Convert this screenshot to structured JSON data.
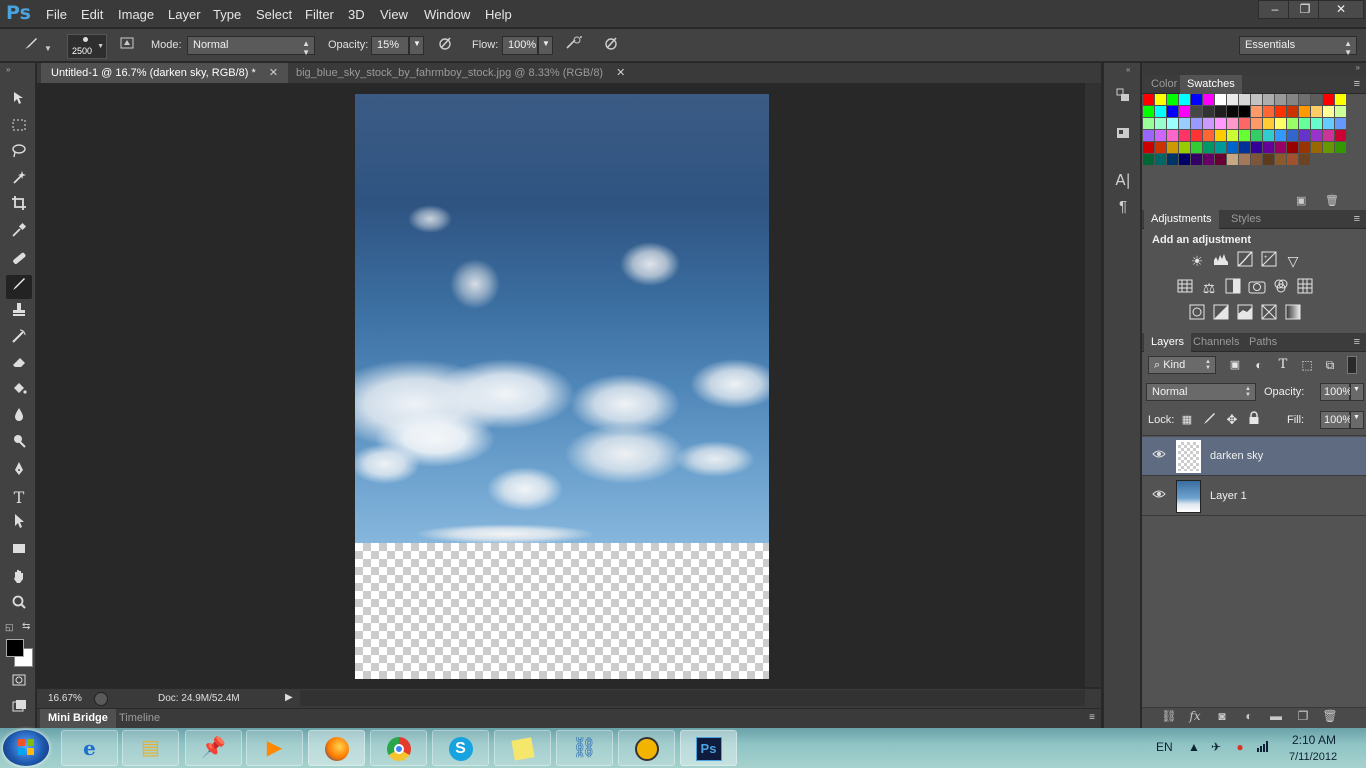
{
  "app": {
    "logo": "Ps",
    "title_colors": {
      "accent": "#4aa3df",
      "selected_layer": "#5e6b80"
    }
  },
  "menu": {
    "items": [
      "File",
      "Edit",
      "Image",
      "Layer",
      "Type",
      "Select",
      "Filter",
      "3D",
      "View",
      "Window",
      "Help"
    ]
  },
  "window_controls": {
    "minimize": "–",
    "restore": "❐",
    "close": "✕"
  },
  "options": {
    "brush_size": "2500",
    "mode_label": "Mode:",
    "mode_value": "Normal",
    "opacity_label": "Opacity:",
    "opacity_value": "15%",
    "flow_label": "Flow:",
    "flow_value": "100%",
    "workspace": "Essentials"
  },
  "tabs": [
    {
      "label": "Untitled-1 @ 16.7% (darken sky, RGB/8) *",
      "close": "✕"
    },
    {
      "label": "big_blue_sky_stock_by_fahrmboy_stock.jpg @ 8.33% (RGB/8)",
      "close": "✕"
    }
  ],
  "status": {
    "zoom": "16.67%",
    "doc": "Doc: 24.9M/52.4M"
  },
  "bottom_tabs": [
    "Mini Bridge",
    "Timeline"
  ],
  "panels": {
    "color_tabs": [
      "Color",
      "Swatches"
    ],
    "adjust_tabs": [
      "Adjustments",
      "Styles"
    ],
    "adjust_heading": "Add an adjustment",
    "layer_tabs": [
      "Layers",
      "Channels",
      "Paths"
    ],
    "kind_filter": "Kind",
    "blend_mode": "Normal",
    "opacity_label": "Opacity:",
    "opacity_value": "100%",
    "lock_label": "Lock:",
    "fill_label": "Fill:",
    "fill_value": "100%",
    "layers": [
      {
        "name": "darken sky"
      },
      {
        "name": "Layer 1"
      }
    ]
  },
  "swatch_colors": [
    "#ff0000",
    "#ffff00",
    "#00ff00",
    "#00ffff",
    "#0000ff",
    "#ff00ff",
    "#ffffff",
    "#ebebeb",
    "#d6d6d6",
    "#c2c2c2",
    "#adadad",
    "#999999",
    "#858585",
    "#707070",
    "#5c5c5c",
    "#ff0000",
    "#ffff00",
    "#00ff00",
    "#00ffff",
    "#0000ff",
    "#ff00ff",
    "#474747",
    "#333333",
    "#1f1f1f",
    "#0a0a0a",
    "#000000",
    "#ff9966",
    "#ff6633",
    "#ff3300",
    "#cc3300",
    "#ff9900",
    "#ffcc66",
    "#ffff99",
    "#ccff99",
    "#99ff99",
    "#99ffcc",
    "#99ffff",
    "#99ccff",
    "#9999ff",
    "#cc99ff",
    "#ff99ff",
    "#ff99cc",
    "#ff6666",
    "#ff9966",
    "#ffcc33",
    "#ffff66",
    "#99ff66",
    "#66ff99",
    "#66ffcc",
    "#66ccff",
    "#6699ff",
    "#9966ff",
    "#cc66ff",
    "#ff66cc",
    "#ff3366",
    "#ff3333",
    "#ff6633",
    "#ffcc00",
    "#ccff33",
    "#66ff33",
    "#33cc66",
    "#33cccc",
    "#3399ff",
    "#3366cc",
    "#6633cc",
    "#9933cc",
    "#cc3399",
    "#cc0033",
    "#cc0000",
    "#cc3300",
    "#cc9900",
    "#99cc00",
    "#33cc33",
    "#009966",
    "#009999",
    "#0066cc",
    "#003399",
    "#330099",
    "#660099",
    "#990066",
    "#990000",
    "#993300",
    "#996600",
    "#669900",
    "#339900",
    "#006633",
    "#006666",
    "#003366",
    "#000066",
    "#330066",
    "#660066",
    "#660033",
    "#c8a882",
    "#a3795a",
    "#7f5538",
    "#5c3a1e",
    "#8b5a2b",
    "#a0522d",
    "#6b4423"
  ],
  "taskbar": {
    "apps": [
      "ie-icon",
      "explorer-icon",
      "pin-icon",
      "media-icon",
      "firefox-icon",
      "chrome-icon",
      "skype-icon",
      "notes-icon",
      "network-icon",
      "globe-icon",
      "photoshop-icon"
    ],
    "lang": "EN",
    "time": "2:10 AM",
    "date": "7/11/2012"
  }
}
